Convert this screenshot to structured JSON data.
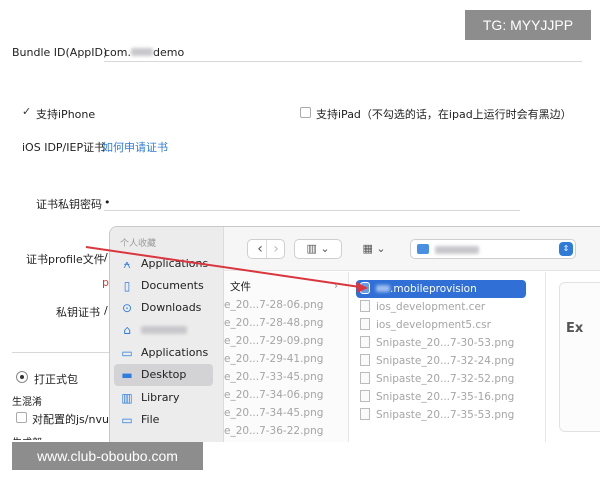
{
  "watermarks": {
    "top": "TG: MYYJJPP",
    "bottom": "www.club-oboubo.com"
  },
  "form": {
    "bundle_id": {
      "label": "Bundle ID(AppID)",
      "value_prefix": "com.",
      "value_suffix": "demo"
    },
    "support_iphone": {
      "label": "支持iPhone",
      "checked": true
    },
    "support_ipad": {
      "label": "支持iPad（不勾选的话，在ipad上运行时会有黑边）",
      "checked": false
    },
    "cert_label": {
      "text": "iOS IDP/IEP证书",
      "link": "如何申请证书"
    },
    "private_key_password": {
      "label": "证书私钥密码",
      "value": "•"
    },
    "profile_file": {
      "label": "证书profile文件",
      "value": "/"
    },
    "profile_p": "p",
    "private_key_cert": {
      "label": "私钥证书",
      "value": "/"
    },
    "formal_package": {
      "label": "打正式包",
      "selected": true
    },
    "obfuscation": {
      "label": "生混淆"
    },
    "obfuscate_config": {
      "label": "对配置的js/nvue"
    },
    "cut_text": "生成部"
  },
  "finder": {
    "sidebar": {
      "heading": "个人收藏",
      "items": [
        {
          "label": "Applications",
          "icon": "applications-icon",
          "selected": false
        },
        {
          "label": "Documents",
          "icon": "document-icon",
          "selected": false
        },
        {
          "label": "Downloads",
          "icon": "downloads-icon",
          "selected": false
        },
        {
          "label": "",
          "icon": "home-icon",
          "selected": false
        },
        {
          "label": "Applications",
          "icon": "folder-icon",
          "selected": false
        },
        {
          "label": "Desktop",
          "icon": "desktop-icon",
          "selected": true
        },
        {
          "label": "Library",
          "icon": "library-icon",
          "selected": false
        },
        {
          "label": "File",
          "icon": "folder-icon",
          "selected": false
        }
      ]
    },
    "toolbar": {
      "back": "‹",
      "forward": "›",
      "view_columns": "▥ ⌄",
      "view_grid": "▦ ⌄"
    },
    "column1": {
      "folder": "文件",
      "files": [
        "e_20...7-28-06.png",
        "e_20...7-28-48.png",
        "e_20...7-29-09.png",
        "e_20...7-29-41.png",
        "e_20...7-33-45.png",
        "e_20...7-34-06.png",
        "e_20...7-34-45.png",
        "e_20...7-36-22.png"
      ]
    },
    "column2": {
      "files": [
        {
          "name": ".mobileprovision",
          "selected": true
        },
        {
          "name": "ios_development.cer",
          "selected": false
        },
        {
          "name": "ios_development5.csr",
          "selected": false
        },
        {
          "name": "Snipaste_20...7-30-53.png",
          "selected": false
        },
        {
          "name": "Snipaste_20...7-32-24.png",
          "selected": false
        },
        {
          "name": "Snipaste_20...7-32-52.png",
          "selected": false
        },
        {
          "name": "Snipaste_20...7-35-16.png",
          "selected": false
        },
        {
          "name": "Snipaste_20...7-35-53.png",
          "selected": false
        }
      ]
    },
    "preview_text": "Ex"
  },
  "colors": {
    "accent": "#2f6fd6",
    "link": "#2f7bd8",
    "arrow": "#d9363e",
    "watermark_bg": "#8d8d8d"
  }
}
